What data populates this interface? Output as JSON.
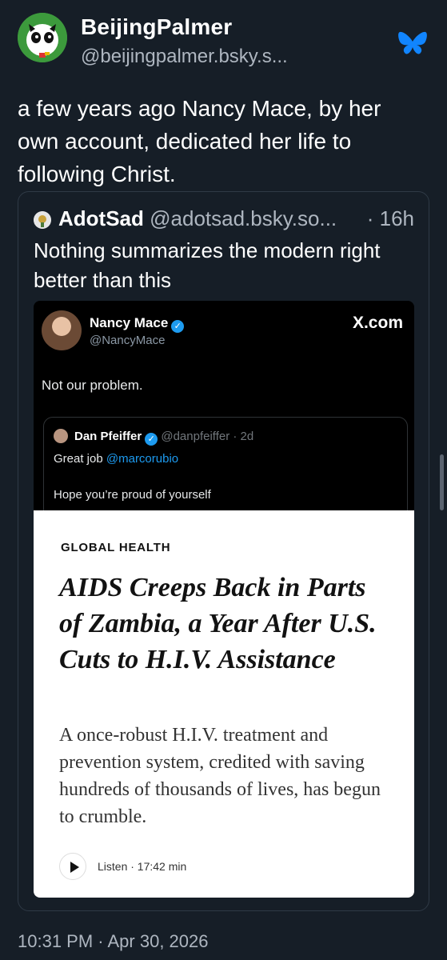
{
  "post": {
    "author_name": "BeijingPalmer",
    "author_handle": "@beijingpalmer.bsky.s...",
    "text": "a few years ago Nancy Mace, by her own account, dedicated her life to following Christ.",
    "timestamp": "10:31 PM · Apr 30, 2026",
    "app_icon": "bluesky-butterfly-icon",
    "accent_color": "#1185fe"
  },
  "quote": {
    "author_name": "AdotSad",
    "author_handle": "@adotsad.bsky.so...",
    "time": "· 16h",
    "text": "Nothing summarizes the modern right better than this"
  },
  "screenshot": {
    "name": "Nancy Mace",
    "handle": "@NancyMace",
    "source": "X.com",
    "text": "Not our problem.",
    "inner": {
      "name": "Dan Pfeiffer",
      "handle": "@danpfeiffer · 2d",
      "line1_prefix": "Great job ",
      "mention": "@marcorubio",
      "line2": "Hope you’re proud of yourself"
    },
    "article": {
      "section": "GLOBAL HEALTH",
      "title": "AIDS Creeps Back in Parts of Zambia, a Year After U.S. Cuts to H.I.V. Assistance",
      "subtitle": "A once-robust H.I.V. treatment and prevention system, credited with saving hundreds of thousands of lives, has begun to crumble.",
      "listen": "Listen · 17:42 min"
    }
  }
}
